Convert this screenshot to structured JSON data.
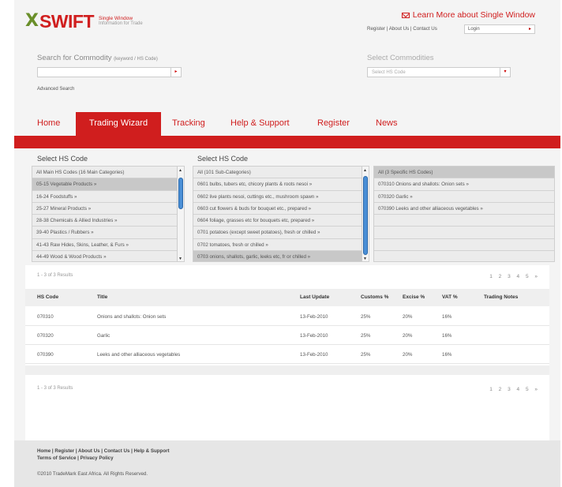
{
  "brand": {
    "name": "SWIFT",
    "mark": "X",
    "tag1": "Single Window",
    "tag2": "Information for Trade"
  },
  "header": {
    "learn_more": "Learn More about Single Window",
    "links": "Register | About Us | Contact Us",
    "login_label": "Login"
  },
  "search": {
    "label": "Search for Commodity",
    "label_hint": "(keyword / HS Code)",
    "value": "",
    "advanced": "Advanced Search"
  },
  "commodities": {
    "label": "Select Commodities",
    "placeholder": "Select HS Code"
  },
  "nav": {
    "home": "Home",
    "trading_wizard": "Trading Wizard",
    "tracking": "Tracking",
    "help": "Help & Support",
    "register": "Register",
    "news": "News"
  },
  "hs_select": {
    "heading_main": "Select HS Code",
    "heading_sub": "Select HS Code",
    "main": [
      "All Main HS Codes (16 Main Categories)",
      "05-15  Vegetable Products »",
      "16-24  Foodstuffs »",
      "25-27  Mineral Products »",
      "28-38  Chemicals & Allied Industries »",
      "39-40  Plastics / Rubbers »",
      "41-43  Raw Hides, Skins, Leather, & Furs »",
      "44-49  Wood & Wood Products »"
    ],
    "sub": [
      "All (101 Sub-Categories)",
      "0601  bulbs, tubers etc, chicory plants & roots nesoi »",
      "0602  live plants nesoi, cuttings etc., mushroom spawn »",
      "0603  cut flowers & buds for bouquet etc., prepared »",
      "0604  foliage, grasses etc for bouquets etc, prepared »",
      "0701  potatoes (except sweet potatoes), fresh or chilled »",
      "0702  tomatoes, fresh or chilled »",
      "0703  onions, shallots, garlic, leeks etc, fr or chilled »"
    ],
    "specific": [
      "All (3 Specific HS Codes)",
      "070310  Onions and shallots: Onion sets »",
      "070320  Garlic »",
      "070390  Leeks and other alliaceous vegetables »"
    ]
  },
  "results": {
    "count": "1 - 3 of 3 Results",
    "pages": "1  2  3  4  5  »",
    "columns": [
      "HS Code",
      "Title",
      "Last Update",
      "Customs %",
      "Excise %",
      "VAT %",
      "Trading Notes"
    ],
    "rows": [
      {
        "code": "070310",
        "title": "Onions and shallots: Onion sets",
        "update": "13-Feb-2010",
        "customs": "25%",
        "excise": "20%",
        "vat": "16%"
      },
      {
        "code": "070320",
        "title": "Garlic",
        "update": "13-Feb-2010",
        "customs": "25%",
        "excise": "20%",
        "vat": "16%"
      },
      {
        "code": "070390",
        "title": "Leeks and other alliaceous vegetables",
        "update": "13-Feb-2010",
        "customs": "25%",
        "excise": "20%",
        "vat": "16%"
      }
    ]
  },
  "footer": {
    "links1": "Home | Register | About Us | Contact Us | Help & Support",
    "links2": "Terms of Service  |  Privacy Policy",
    "copyright": "©2010 TradeMark East Africa. All Rights Reserved."
  },
  "colors": {
    "accent": "#d01e1e",
    "logo_mark": "#6a8f2a",
    "scroll_thumb": "#4a8fd6"
  }
}
